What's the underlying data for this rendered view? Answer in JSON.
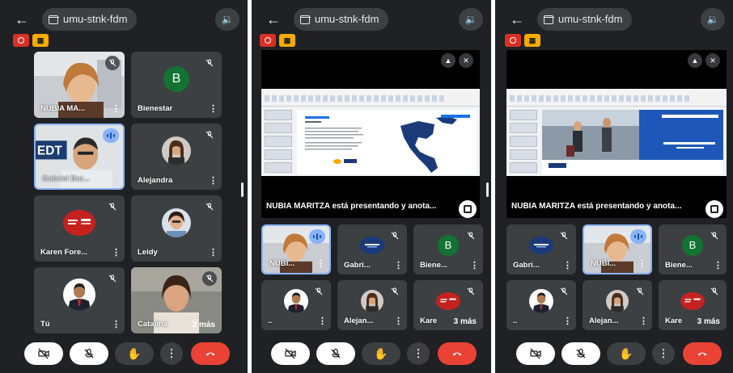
{
  "meeting_code": "umu-stnk-fdm",
  "colors": {
    "background": "#202124",
    "tile": "#3c4043",
    "accent": "#8ab4f8",
    "end_call": "#ea4335",
    "record": "#d93025",
    "camera_badge": "#f9ab00",
    "letter_avatar": "#137333"
  },
  "icons": {
    "back": "arrow-left-icon",
    "meeting": "calendar-icon",
    "speaker": "speaker-icon",
    "record": "record-icon",
    "camera_badge": "no-camera-icon",
    "mute": "mic-off-icon",
    "pin": "pin-icon",
    "fullscreen": "fullscreen-icon",
    "more": "more-vert-icon",
    "hand": "raise-hand-icon",
    "hang_up": "call-end-icon"
  },
  "panel1": {
    "tiles": [
      {
        "name": "NUBIA MA..."
      },
      {
        "name": "Bienestar",
        "letter": "B"
      },
      {
        "name": "Gabriel Bar..."
      },
      {
        "name": "Alejandra"
      },
      {
        "name": "Karen Fore..."
      },
      {
        "name": "Leidy"
      },
      {
        "name": "Tú"
      },
      {
        "name": "Catalina",
        "more_count": "2 más"
      }
    ]
  },
  "panel2": {
    "presenting_label": "NUBIA MARITZA está presentando y anota...",
    "tiles": [
      {
        "name": "NUBI..."
      },
      {
        "name": "Gabri..."
      },
      {
        "name": "Biene...",
        "letter": "B"
      },
      {
        "name": ".."
      },
      {
        "name": "Alejan..."
      },
      {
        "name": "Kare",
        "more_count": "3 más"
      }
    ]
  },
  "panel3": {
    "presenting_label": "NUBIA MARITZA está presentando y anota...",
    "tiles": [
      {
        "name": "Gabri..."
      },
      {
        "name": "NUBI..."
      },
      {
        "name": "Biene...",
        "letter": "B"
      },
      {
        "name": ".."
      },
      {
        "name": "Alejan..."
      },
      {
        "name": "Kare",
        "more_count": "3 más"
      }
    ]
  }
}
